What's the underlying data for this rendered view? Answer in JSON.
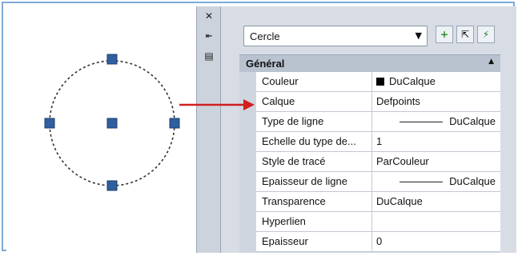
{
  "object_selector": {
    "value": "Cercle",
    "arrow_icon": "dropdown-arrow-icon"
  },
  "toolbar": {
    "buttons": [
      {
        "name": "toggle-pickadd-button",
        "icon": "plus-icon",
        "glyph": "+"
      },
      {
        "name": "select-objects-button",
        "icon": "select-objects-icon",
        "glyph": "⇱"
      },
      {
        "name": "quick-select-button",
        "icon": "quick-select-icon",
        "glyph": "⚡"
      }
    ]
  },
  "palette_bar": {
    "close_icon": "close-icon",
    "autohide_icon": "autohide-icon",
    "properties_icon": "properties-icon"
  },
  "section": {
    "title": "Général",
    "toggle_icon": "collapse-up-icon"
  },
  "properties": [
    {
      "label": "Couleur",
      "value": "DuCalque",
      "kind": "color",
      "swatch": "#000000"
    },
    {
      "label": "Calque",
      "value": "Defpoints",
      "kind": "text"
    },
    {
      "label": "Type de ligne",
      "value": "DuCalque",
      "kind": "line"
    },
    {
      "label": "Echelle du type de...",
      "value": "1",
      "kind": "text"
    },
    {
      "label": "Style de tracé",
      "value": "ParCouleur",
      "kind": "text"
    },
    {
      "label": "Epaisseur de ligne",
      "value": "DuCalque",
      "kind": "line"
    },
    {
      "label": "Transparence",
      "value": "DuCalque",
      "kind": "text"
    },
    {
      "label": "Hyperlien",
      "value": "",
      "kind": "text"
    },
    {
      "label": "Epaisseur",
      "value": "0",
      "kind": "text"
    }
  ],
  "colors": {
    "grip": "#2f5f9f",
    "arrow": "#d21f1f",
    "accent_border": "#7fa9d6"
  }
}
